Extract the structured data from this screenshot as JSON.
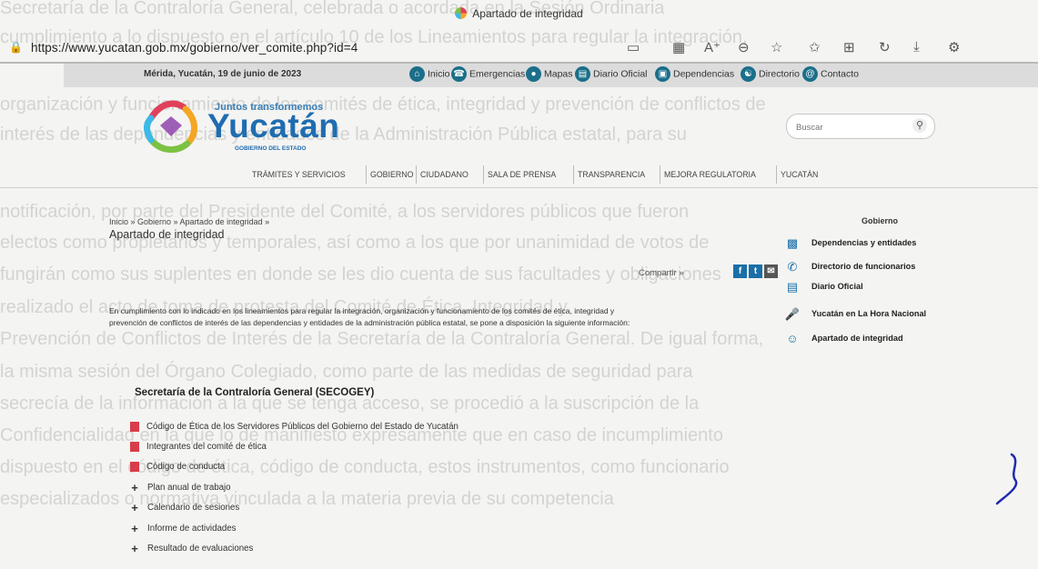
{
  "background_text": [
    "Secretaría de la Contraloría General, celebrada o acordada en la Sesión Ordinaria",
    "cumplimiento a lo dispuesto en el artículo 10 de los Lineamientos para regular la integración,",
    "organización y funcionamiento de los comités de ética, integridad y prevención de conflictos de",
    "interés de las dependencias y entidades de la Administración Pública estatal, para su",
    "notificación, por parte del Presidente del Comité, a los servidores públicos que fueron",
    "electos como propietarios y temporales, así como a los que por unanimidad de votos de",
    "fungirán como sus suplentes en donde se les dio cuenta de sus facultades y obligaciones",
    "realizado el acto de toma de protesta del Comité de Ética, Integridad y",
    "Prevención de Conflictos de Interés de la Secretaría de la Contraloría General. De igual forma,",
    "la misma sesión del Órgano Colegiado, como parte de las medidas de seguridad para",
    "secrecía de la información a la que se tenga acceso, se procedió a la suscripción de la",
    "Confidencialidad en la que lo de manifiesto expresamente que en caso de incumplimiento",
    "dispuesto en el código de ética, código de conducta, estos instrumentos, como funcionario",
    "especializados o normativa vinculada a la materia previa de su competencia"
  ],
  "browser": {
    "tab_title": "Apartado de integridad",
    "url": "https://www.yucatan.gob.mx/gobierno/ver_comite.php?id=4",
    "toolbar_icons": [
      "reader-view-icon",
      "grid-icon",
      "read-aloud-icon",
      "zoom-icon",
      "favorite-icon",
      "favorites-bar-icon",
      "collections-icon",
      "history-icon",
      "download-icon",
      "extensions-icon"
    ]
  },
  "site": {
    "date": "Mérida, Yucatán, 19 de junio de 2023",
    "top_links": [
      "Inicio",
      "Emergencias",
      "Mapas",
      "Diario Oficial",
      "Dependencias",
      "Directorio",
      "Contacto"
    ],
    "logo": {
      "tagline": "Juntos transformemos",
      "name": "Yucatán",
      "sub": "GOBIERNO DEL ESTADO"
    },
    "search_placeholder": "Buscar",
    "nav": [
      "TRÁMITES Y SERVICIOS",
      "GOBIERNO",
      "CIUDADANO",
      "SALA DE PRENSA",
      "TRANSPARENCIA",
      "MEJORA REGULATORIA",
      "YUCATÁN"
    ]
  },
  "content": {
    "breadcrumb": "Inicio » Gobierno » Apartado de integridad »",
    "title": "Apartado de integridad",
    "share_label": "Compartir »",
    "intro": "En cumplimiento con lo indicado en los lineamientos para regular la integración, organización y funcionamiento de los comités de ética, integridad y prevención de conflictos de interés de las dependencias y entidades de la administración pública estatal, se pone a disposición la siguiente información:",
    "org_title": "Secretaría de la Contraloría General (SECOGEY)",
    "documents": [
      "Código de Ética de los Servidores Públicos del Gobierno del Estado de Yucatán",
      "Integrantes del comité de ética",
      "Código de conducta"
    ],
    "expandables": [
      "Plan anual de trabajo",
      "Calendario de sesiones",
      "Informe de actividades",
      "Resultado de evaluaciones"
    ]
  },
  "sidebar": {
    "heading": "Gobierno",
    "items": [
      "Dependencias y entidades",
      "Directorio de funcionarios",
      "Diario Oficial",
      "Yucatán en La Hora Nacional",
      "Apartado de integridad"
    ]
  }
}
